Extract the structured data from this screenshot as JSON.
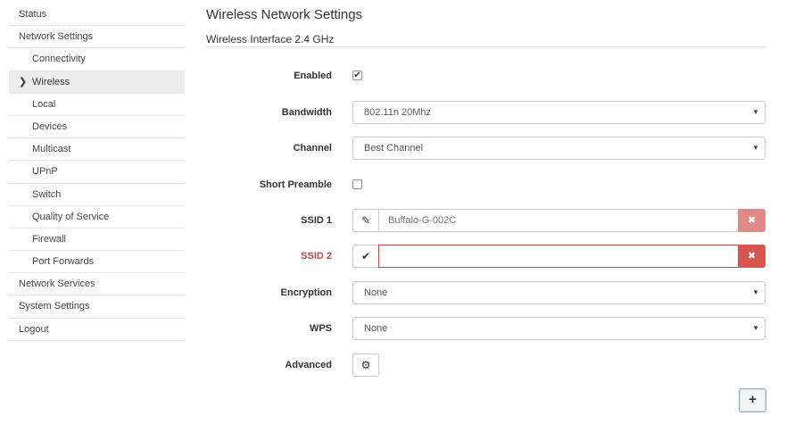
{
  "sidebar": {
    "items": [
      {
        "label": "Status"
      },
      {
        "label": "Network Settings"
      },
      {
        "label": "Connectivity"
      },
      {
        "label": "Wireless"
      },
      {
        "label": "Local"
      },
      {
        "label": "Devices"
      },
      {
        "label": "Multicast"
      },
      {
        "label": "UPnP"
      },
      {
        "label": "Switch"
      },
      {
        "label": "Quality of Service"
      },
      {
        "label": "Firewall"
      },
      {
        "label": "Port Forwards"
      },
      {
        "label": "Network Services"
      },
      {
        "label": "System Settings"
      },
      {
        "label": "Logout"
      }
    ],
    "active_item": "Wireless"
  },
  "main": {
    "title": "Wireless Network Settings",
    "subtitle": "Wireless Interface 2.4 GHz",
    "enabled": {
      "label": "Enabled",
      "checked": true,
      "mark": "✔"
    },
    "bandwidth": {
      "label": "Bandwidth",
      "value": "802.11n 20Mhz"
    },
    "channel": {
      "label": "Channel",
      "value": "Best Channel"
    },
    "short_preamble": {
      "label": "Short Preamble",
      "checked": false
    },
    "ssid1": {
      "label": "SSID 1",
      "value": "Buffalo-G-002C"
    },
    "ssid2": {
      "label": "SSID 2",
      "value": ""
    },
    "encryption": {
      "label": "Encryption",
      "value": "None"
    },
    "wps": {
      "label": "WPS",
      "value": "None"
    },
    "advanced": {
      "label": "Advanced"
    }
  },
  "icons": {
    "chevron": "chevron-right-icon",
    "caret": "▼",
    "pencil": "✎",
    "check": "✔",
    "delete": "✖",
    "gear": "⚙",
    "plus": "+"
  },
  "colors": {
    "error": "#b94a48",
    "danger": "#d9534f",
    "danger_light": "#e08a87"
  }
}
